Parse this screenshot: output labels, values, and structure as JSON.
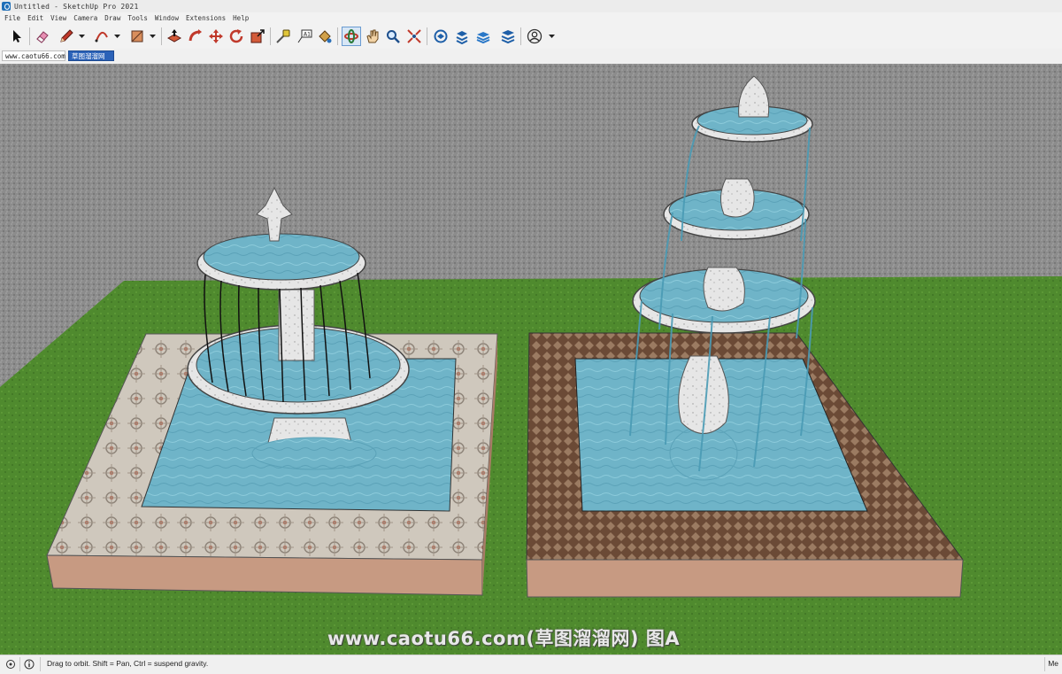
{
  "window": {
    "title": "Untitled - SketchUp Pro 2021"
  },
  "menu": [
    "File",
    "Edit",
    "View",
    "Camera",
    "Draw",
    "Tools",
    "Window",
    "Extensions",
    "Help"
  ],
  "toolbar": {
    "tools": [
      {
        "name": "select-tool",
        "icon": "arrow-cursor-icon"
      },
      {
        "name": "eraser-tool",
        "icon": "eraser-icon"
      },
      {
        "name": "line-tool",
        "icon": "pencil-icon"
      },
      {
        "name": "arc-tool",
        "icon": "arc-icon"
      },
      {
        "name": "shapes-tool",
        "icon": "rectangle-icon"
      },
      {
        "name": "push-pull-tool",
        "icon": "push-pull-icon"
      },
      {
        "name": "move-tool",
        "icon": "move-icon"
      },
      {
        "name": "rotate-tool",
        "icon": "rotate-icon"
      },
      {
        "name": "scale-tool",
        "icon": "scale-icon"
      },
      {
        "name": "offset-tool",
        "icon": "offset-icon"
      },
      {
        "name": "tape-measure-tool",
        "icon": "tape-measure-icon"
      },
      {
        "name": "text-tool",
        "icon": "text-icon"
      },
      {
        "name": "paint-bucket-tool",
        "icon": "paint-bucket-icon"
      },
      {
        "name": "orbit-tool",
        "icon": "orbit-icon"
      },
      {
        "name": "pan-tool",
        "icon": "hand-icon"
      },
      {
        "name": "zoom-tool",
        "icon": "zoom-icon"
      },
      {
        "name": "zoom-extents-tool",
        "icon": "zoom-extents-icon"
      },
      {
        "name": "3d-warehouse",
        "icon": "warehouse-icon"
      },
      {
        "name": "extension-warehouse",
        "icon": "extension-icon"
      },
      {
        "name": "layout-send",
        "icon": "layers-icon"
      },
      {
        "name": "extension-manager",
        "icon": "extension-manager-icon"
      },
      {
        "name": "account",
        "icon": "user-icon"
      }
    ]
  },
  "tabs": [
    {
      "label": "www.caotu66.com"
    },
    {
      "label": "草图溜溜网"
    }
  ],
  "status": {
    "hint": "Drag to orbit. Shift = Pan, Ctrl = suspend gravity.",
    "right": "Me"
  },
  "watermark": {
    "text": "www.caotu66.com(草图溜溜网) 图A"
  },
  "colors": {
    "grass": "#4f8a2e",
    "water": "#6fb4c8",
    "ground": "#8f8f8f",
    "tile_light": "#cfc8bd",
    "tile_dark": "#6b4a36",
    "base": "#c79a82",
    "marble": "#e6e6e6"
  }
}
